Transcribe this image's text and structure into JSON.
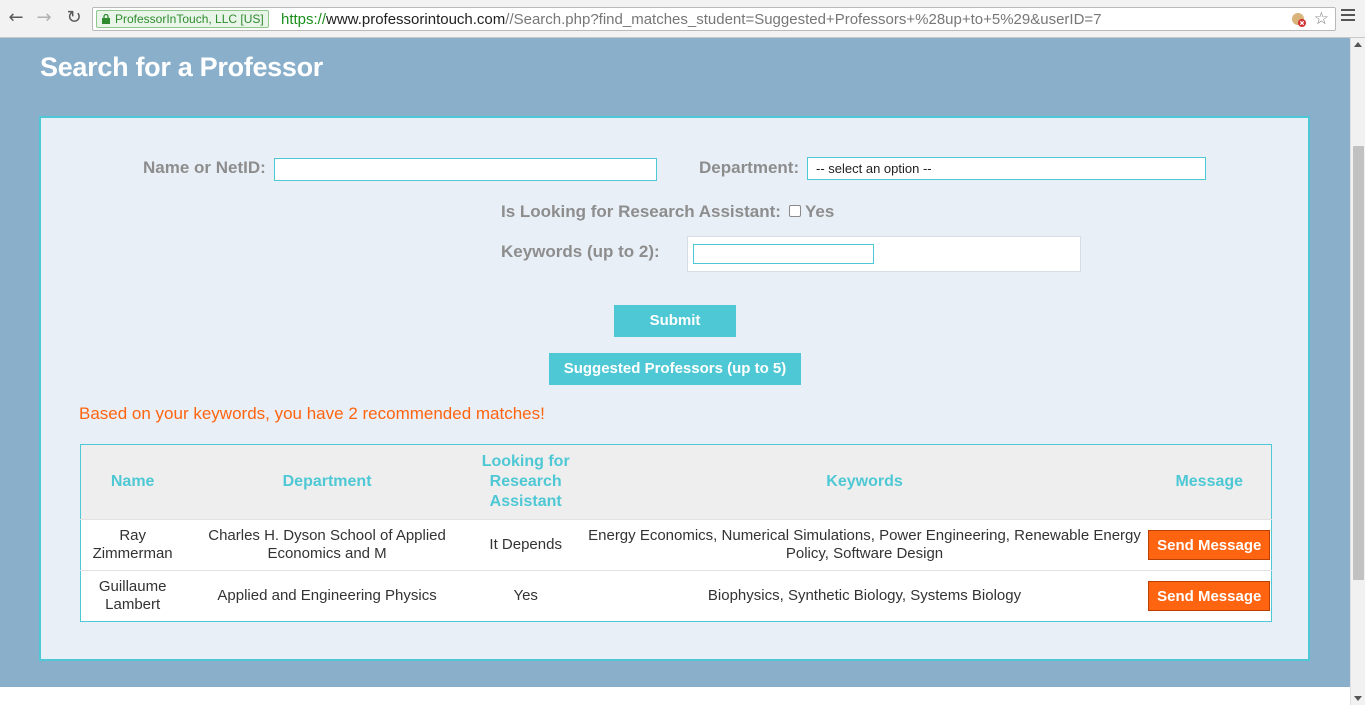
{
  "browser": {
    "ev_badge": "ProfessorInTouch, LLC [US]",
    "url_scheme": "https://",
    "url_host": "www.professorintouch.com",
    "url_path": "//Search.php?find_matches_student=Suggested+Professors+%28up+to+5%29&userID=7",
    "back_icon": "back-arrow-icon",
    "forward_icon": "forward-arrow-icon",
    "reload_icon": "reload-icon",
    "star_icon": "star-icon",
    "menu_icon": "hamburger-menu-icon"
  },
  "page": {
    "title": "Search for a Professor"
  },
  "form": {
    "name_label": "Name or NetID:",
    "name_value": "",
    "department_label": "Department:",
    "department_selected": "-- select an option --",
    "research_label": "Is Looking for Research Assistant:",
    "research_checkbox_label": "Yes",
    "research_checked": false,
    "keywords_label": "Keywords (up to 2):",
    "keywords_value": "",
    "submit_label": "Submit",
    "suggested_label": "Suggested Professors (up to 5)"
  },
  "results": {
    "message": "Based on your keywords, you have 2 recommended matches!",
    "columns": [
      "Name",
      "Department",
      "Looking for Research Assistant",
      "Keywords",
      "Message"
    ],
    "rows": [
      {
        "name": "Ray Zimmerman",
        "department": "Charles H. Dyson School of Applied Economics and M",
        "looking": "It Depends",
        "keywords": "Energy Economics, Numerical Simulations, Power Engineering, Renewable Energy Policy, Software Design",
        "action": "Send Message"
      },
      {
        "name": "Guillaume Lambert",
        "department": "Applied and Engineering Physics",
        "looking": "Yes",
        "keywords": "Biophysics, Synthetic Biology, Systems Biology",
        "action": "Send Message"
      }
    ]
  },
  "colors": {
    "page_bg": "#8aafcb",
    "panel_bg": "#e8eff6",
    "accent_teal": "#4ec8d4",
    "accent_orange": "#ff6410"
  }
}
